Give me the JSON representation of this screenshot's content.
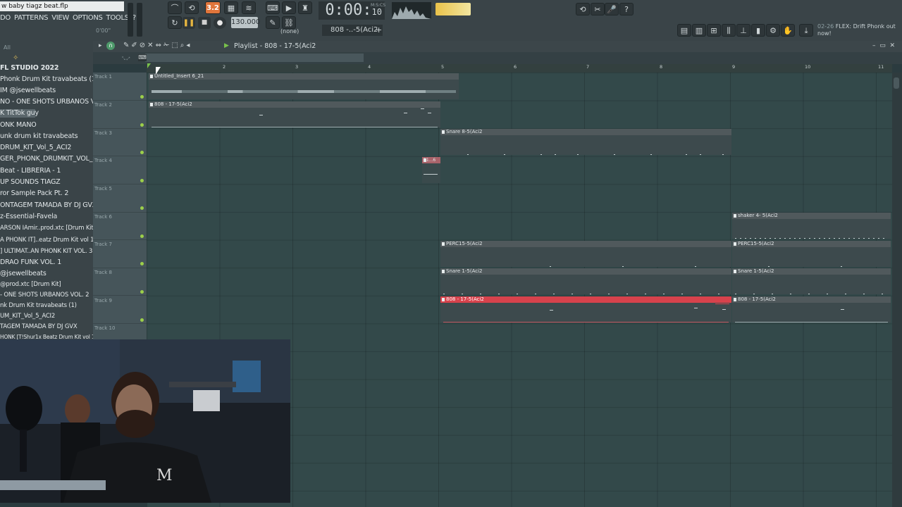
{
  "window": {
    "title": "w baby tiagz beat.flp"
  },
  "menu": [
    "DO",
    "PATTERNS",
    "VIEW",
    "OPTIONS",
    "TOOLS",
    "?"
  ],
  "hint_time": "0'00\"",
  "transport": {
    "pattern_song_label": "3.2",
    "tempo": "130.000",
    "time_main": "0:00:",
    "time_frac": "10",
    "time_unit": "M:S:CS",
    "pattern_selector": "808 -..-5(Aci2",
    "channel_none": "(none)"
  },
  "news": {
    "date": "02-26",
    "text": "FLEX: Drift Phonk out now!"
  },
  "browser": {
    "filter": "All",
    "items": [
      "FL STUDIO 2022",
      "Phonk Drum Kit travabeats (1)",
      "IM @jsewellbeats",
      "NO - ONE SHOTS URBANOS VOL. 2",
      "K TitTok guy",
      "ONK MANO",
      "unk drum kit travabeats",
      "DRUM_KIT_Vol_5_ACI2",
      "GER_PHONK_DRUMKIT_VOL_3",
      "Beat - LIBRERIA - 1",
      "UP SOUNDS TIAGZ",
      "ror Sample Pack Pt. 2",
      "ONTAGEM TAMADA BY DJ GVX",
      "z-Essential-Favela",
      "ARSON IAmir..prod.xtc [Drum Kit]",
      "A PHONK IT]..eatz Drum Kit vol 1",
      "] ULTIMAT..AN PHONK KIT VOL. 3",
      "DRAO FUNK VOL. 1",
      "@jsewellbeats",
      "@prod.xtc [Drum Kit]",
      "- ONE SHOTS URBANOS VOL. 2",
      "nk Drum Kit travabeats (1)",
      "UM_KIT_Vol_5_ACI2",
      "TAGEM TAMADA BY DJ GVX",
      "HONK [T!Shur1x Beatz Drum Kit vol 1"
    ]
  },
  "playlist": {
    "title": "Playlist - 808 - 17-5(Aci2",
    "ruler": [
      "2",
      "3",
      "4",
      "5",
      "6",
      "7",
      "8",
      "9",
      "10",
      "11"
    ],
    "tracks": [
      "Track 1",
      "Track 2",
      "Track 3",
      "Track 4",
      "Track 5",
      "Track 6",
      "Track 7",
      "Track 8",
      "Track 9",
      "Track 10"
    ],
    "clips": {
      "insert": "Untitled_Insert 6_21",
      "c808a": "808 - 17-5(Aci2",
      "snare8": "Snare 8-5(Aci2",
      "small": "11...6",
      "shaker": "shaker 4- 5(Aci2",
      "perc1": "PERC15-5(Aci2",
      "perc2": "PERC15-5(Aci2",
      "snare1a": "Snare 1-5(Aci2",
      "snare1b": "Snare 1-5(Aci2",
      "c808red": "808 - 17-5(Aci2",
      "c808b": "808 - 17-5(Aci2"
    }
  },
  "colors": {
    "accent_orange": "#e0753b",
    "clip_selected": "#d7424c",
    "led_green": "#9ccf4a"
  }
}
